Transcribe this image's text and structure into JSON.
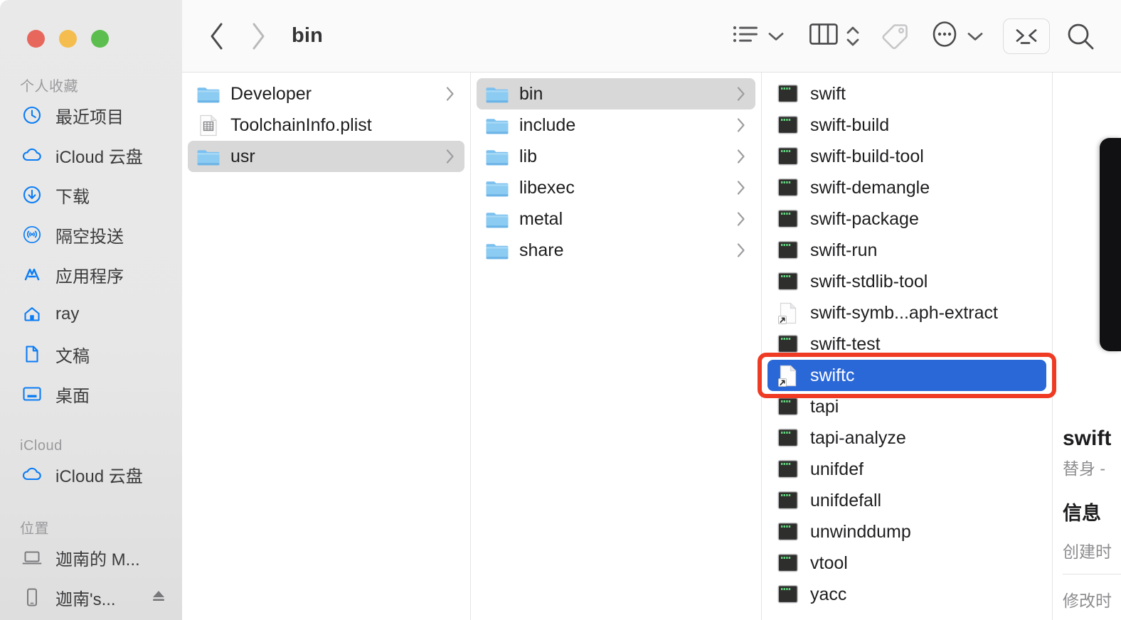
{
  "window": {
    "title": "bin",
    "traffic_lights": [
      "close",
      "minimize",
      "maximize"
    ],
    "colors": {
      "close": "#e8675c",
      "minimize": "#f4bd4e",
      "maximize": "#5cbe4f",
      "selection_blue": "#2a68d8",
      "annotation_red": "#ef3b23",
      "sidebar_accent": "#0a7cf5"
    }
  },
  "toolbar": {
    "back_label": "‹",
    "forward_label": "›",
    "view_list_label": "list-view",
    "view_list_chevron": "⌄",
    "view_column_label": "column-view",
    "group_stepper_label": "group-by",
    "tag_label": "tags",
    "more_label": "more-actions",
    "more_chevron": "⌄",
    "terminal_label": "open-terminal",
    "search_label": "search"
  },
  "sidebar": {
    "sections": [
      {
        "title": "个人收藏",
        "items": [
          {
            "label": "最近项目",
            "icon": "clock-icon",
            "tone": "blue"
          },
          {
            "label": "iCloud 云盘",
            "icon": "cloud-icon",
            "tone": "blue"
          },
          {
            "label": "下载",
            "icon": "download-icon",
            "tone": "blue"
          },
          {
            "label": "隔空投送",
            "icon": "airdrop-icon",
            "tone": "blue"
          },
          {
            "label": "应用程序",
            "icon": "applications-icon",
            "tone": "blue"
          },
          {
            "label": "ray",
            "icon": "home-icon",
            "tone": "blue"
          },
          {
            "label": "文稿",
            "icon": "document-icon",
            "tone": "blue"
          },
          {
            "label": "桌面",
            "icon": "desktop-icon",
            "tone": "blue"
          }
        ]
      },
      {
        "title": "iCloud",
        "items": [
          {
            "label": "iCloud 云盘",
            "icon": "cloud-icon",
            "tone": "blue"
          }
        ]
      },
      {
        "title": "位置",
        "items": [
          {
            "label": "迦南的 M...",
            "icon": "laptop-icon",
            "tone": "gray"
          },
          {
            "label": "迦南's...",
            "icon": "iphone-icon",
            "tone": "gray",
            "eject": true
          }
        ]
      }
    ]
  },
  "columns": [
    {
      "name": "column-toolchain",
      "items": [
        {
          "label": "Developer",
          "icon": "folder-icon",
          "chevron": true,
          "state": "normal"
        },
        {
          "label": "ToolchainInfo.plist",
          "icon": "plist-icon",
          "chevron": false,
          "state": "normal"
        },
        {
          "label": "usr",
          "icon": "folder-icon",
          "chevron": true,
          "state": "selected-inactive"
        }
      ]
    },
    {
      "name": "column-usr",
      "items": [
        {
          "label": "bin",
          "icon": "folder-icon",
          "chevron": true,
          "state": "selected-inactive"
        },
        {
          "label": "include",
          "icon": "folder-icon",
          "chevron": true,
          "state": "normal"
        },
        {
          "label": "lib",
          "icon": "folder-icon",
          "chevron": true,
          "state": "normal"
        },
        {
          "label": "libexec",
          "icon": "folder-icon",
          "chevron": true,
          "state": "normal"
        },
        {
          "label": "metal",
          "icon": "folder-icon",
          "chevron": true,
          "state": "normal"
        },
        {
          "label": "share",
          "icon": "folder-icon",
          "chevron": true,
          "state": "normal"
        }
      ]
    },
    {
      "name": "column-bin",
      "items": [
        {
          "label": "swift",
          "icon": "executable-icon",
          "chevron": false,
          "state": "normal"
        },
        {
          "label": "swift-build",
          "icon": "executable-icon",
          "chevron": false,
          "state": "normal"
        },
        {
          "label": "swift-build-tool",
          "icon": "executable-icon",
          "chevron": false,
          "state": "normal"
        },
        {
          "label": "swift-demangle",
          "icon": "executable-icon",
          "chevron": false,
          "state": "normal"
        },
        {
          "label": "swift-package",
          "icon": "executable-icon",
          "chevron": false,
          "state": "normal"
        },
        {
          "label": "swift-run",
          "icon": "executable-icon",
          "chevron": false,
          "state": "normal"
        },
        {
          "label": "swift-stdlib-tool",
          "icon": "executable-icon",
          "chevron": false,
          "state": "normal"
        },
        {
          "label": "swift-symb...aph-extract",
          "icon": "alias-icon",
          "chevron": false,
          "state": "normal"
        },
        {
          "label": "swift-test",
          "icon": "executable-icon",
          "chevron": false,
          "state": "normal"
        },
        {
          "label": "swiftc",
          "icon": "alias-icon",
          "chevron": false,
          "state": "selected"
        },
        {
          "label": "tapi",
          "icon": "executable-icon",
          "chevron": false,
          "state": "normal"
        },
        {
          "label": "tapi-analyze",
          "icon": "executable-icon",
          "chevron": false,
          "state": "normal"
        },
        {
          "label": "unifdef",
          "icon": "executable-icon",
          "chevron": false,
          "state": "normal"
        },
        {
          "label": "unifdefall",
          "icon": "executable-icon",
          "chevron": false,
          "state": "normal"
        },
        {
          "label": "unwinddump",
          "icon": "executable-icon",
          "chevron": false,
          "state": "normal"
        },
        {
          "label": "vtool",
          "icon": "executable-icon",
          "chevron": false,
          "state": "normal"
        },
        {
          "label": "yacc",
          "icon": "executable-icon",
          "chevron": false,
          "state": "normal"
        }
      ]
    }
  ],
  "preview": {
    "title": "swift",
    "subtitle": "替身 -",
    "info_heading": "信息",
    "created_label": "创建时",
    "modified_label": "修改时"
  }
}
